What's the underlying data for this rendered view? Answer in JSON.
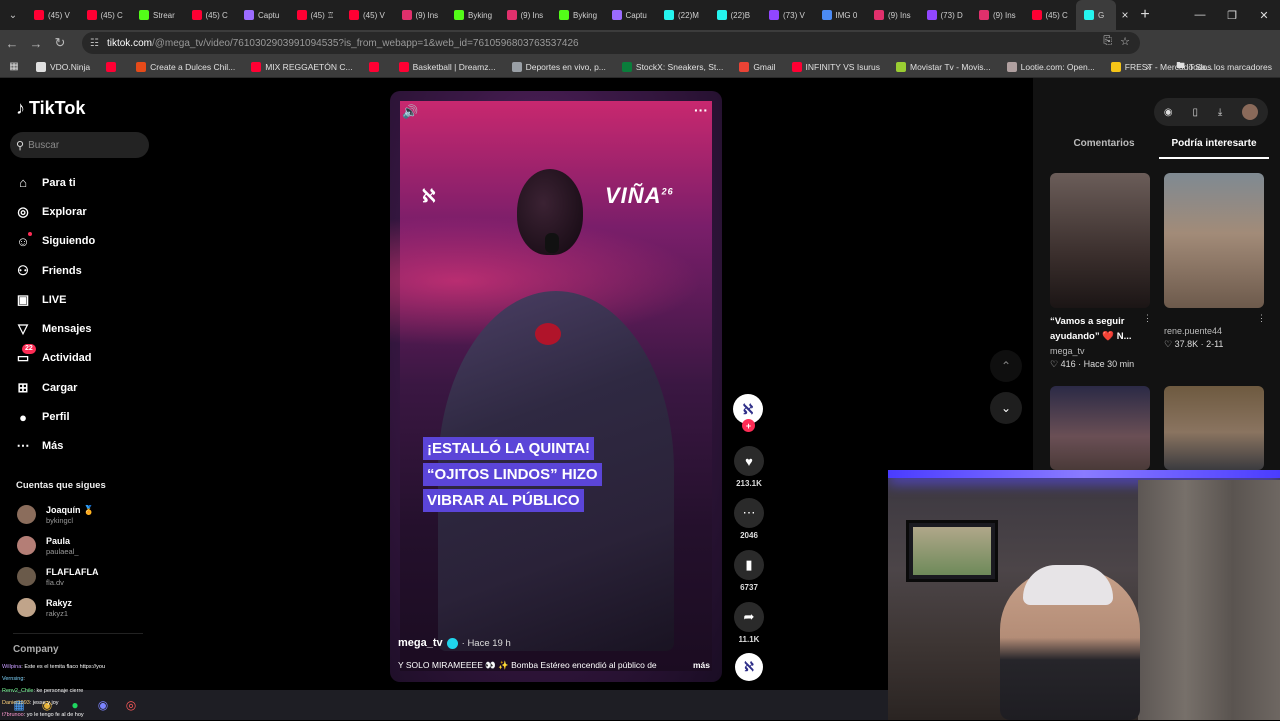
{
  "browser": {
    "tabs": [
      {
        "label": "(45) V",
        "color": "#ff0033"
      },
      {
        "label": "(45) C",
        "color": "#ff0033"
      },
      {
        "label": "Strear",
        "color": "#53fc18"
      },
      {
        "label": "(45) C",
        "color": "#ff0033"
      },
      {
        "label": "Captu",
        "color": "#9b6bff"
      },
      {
        "label": "(45) ♖",
        "color": "#ff0033"
      },
      {
        "label": "(45) V",
        "color": "#ff0033"
      },
      {
        "label": "(9) Ins",
        "color": "#e1306c"
      },
      {
        "label": "Byking",
        "color": "#53fc18"
      },
      {
        "label": "(9) Ins",
        "color": "#e1306c"
      },
      {
        "label": "Byking",
        "color": "#53fc18"
      },
      {
        "label": "Captu",
        "color": "#9b6bff"
      },
      {
        "label": "(22)M",
        "color": "#25f4ee"
      },
      {
        "label": "(22)B",
        "color": "#25f4ee"
      },
      {
        "label": "(73) V",
        "color": "#9146ff"
      },
      {
        "label": "IMG 0",
        "color": "#4b8bf5"
      },
      {
        "label": "(9) Ins",
        "color": "#e1306c"
      },
      {
        "label": "(73) D",
        "color": "#9146ff"
      },
      {
        "label": "(9) Ins",
        "color": "#e1306c"
      },
      {
        "label": "(45) C",
        "color": "#ff0033"
      }
    ],
    "active_tab": "G",
    "url_domain": "tiktok.com",
    "url_rest": "/@mega_tv/video/7610302903991094535?is_from_webapp=1&web_id=7610596803763537426",
    "bookmarks": [
      {
        "label": "VDO.Ninja",
        "color": "#e0e0e0"
      },
      {
        "label": "",
        "color": "#ff0033"
      },
      {
        "label": "Create a Dulces Chil...",
        "color": "#e64a19"
      },
      {
        "label": "MIX REGGAETÓN C...",
        "color": "#ff0033"
      },
      {
        "label": "",
        "color": "#ff0033"
      },
      {
        "label": "Basketball | Dreamz...",
        "color": "#ff0033"
      },
      {
        "label": "Deportes en vivo, p...",
        "color": "#9aa0a6"
      },
      {
        "label": "StockX: Sneakers, St...",
        "color": "#0a7d3b"
      },
      {
        "label": "Gmail",
        "color": "#ea4335"
      },
      {
        "label": "INFINITY VS Isurus",
        "color": "#ff0033"
      },
      {
        "label": "Movistar Tv - Movis...",
        "color": "#9acd32"
      },
      {
        "label": "Lootie.com: Open...",
        "color": "#b0a0a0"
      },
      {
        "label": "FREST - Mercado Sa...",
        "color": "#f5c518"
      }
    ],
    "bookmarks_more": "»",
    "all_bookmarks": "Todos los marcadores"
  },
  "tiktok": {
    "logo": "TikTok",
    "search_placeholder": "Buscar",
    "nav": [
      {
        "label": "Para ti",
        "icon": "⌂"
      },
      {
        "label": "Explorar",
        "icon": "◎"
      },
      {
        "label": "Siguiendo",
        "icon": "☺"
      },
      {
        "label": "Friends",
        "icon": "⚇"
      },
      {
        "label": "LIVE",
        "icon": "▣"
      },
      {
        "label": "Mensajes",
        "icon": "▽"
      },
      {
        "label": "Actividad",
        "icon": "▭"
      },
      {
        "label": "Cargar",
        "icon": "⊞"
      },
      {
        "label": "Perfil",
        "icon": "●"
      },
      {
        "label": "Más",
        "icon": "⋯"
      }
    ],
    "activity_badge": "22",
    "following_title": "Cuentas que sigues",
    "following": [
      {
        "name": "Joaquín 🏅",
        "handle": "bykingcl",
        "color": "#8b6d5c"
      },
      {
        "name": "Paula",
        "handle": "paulaeal_",
        "color": "#b47e76"
      },
      {
        "name": "FLAFLAFLA",
        "handle": "fla.dv",
        "color": "#6a5a4a"
      },
      {
        "name": "Rakyz",
        "handle": "rakyz1",
        "color": "#c0a48a"
      }
    ],
    "company": "Company"
  },
  "chat": [
    {
      "user": "Willpina",
      "msg": ": Este es el temita flaco https://you"
    },
    {
      "user": "Vernsing",
      "msg": ": "
    },
    {
      "user": "Renv2_Chile",
      "msg": ": ke personaje cierre"
    },
    {
      "user": "Daniel1993",
      "msg": ": jesse y joy"
    },
    {
      "user": "t7brunoo",
      "msg": ": yo le tengo fe al de hoy"
    }
  ],
  "video": {
    "channel_logo": "ℵ",
    "festival_logo": "VIÑA",
    "festival_year": "26",
    "caption_lines": [
      "¡ESTALLÓ LA QUINTA!",
      "“OJITOS LINDOS” HIZO",
      "VIBRAR AL PÚBLICO"
    ],
    "author": "mega_tv",
    "time": "· Hace 19 h",
    "description": "Y SOLO MIRAMEEEE 👀 ✨ Bomba Estéreo encendió al público de",
    "more": "más",
    "likes": "213.1K",
    "comments": "2046",
    "saves": "6737",
    "shares": "11.1K"
  },
  "right_panel": {
    "tabs": [
      "Comentarios",
      "Podría interesarte"
    ],
    "active_tab": "Podría interesarte",
    "cards": [
      {
        "title": "“Vamos a seguir ayudando” ❤️ N...",
        "author": "mega_tv",
        "stats": "♡ 416 · Hace 30 min"
      },
      {
        "title": "",
        "author": "rene.puente44",
        "stats": "♡ 37.8K · 2-11"
      },
      {
        "title": "",
        "author": "",
        "stats": ""
      },
      {
        "title": "",
        "author": "",
        "stats": ""
      }
    ]
  },
  "colors": {
    "accent": "#fe2c55",
    "caption_bg": "#5b45d8",
    "verified": "#20d5ec"
  }
}
